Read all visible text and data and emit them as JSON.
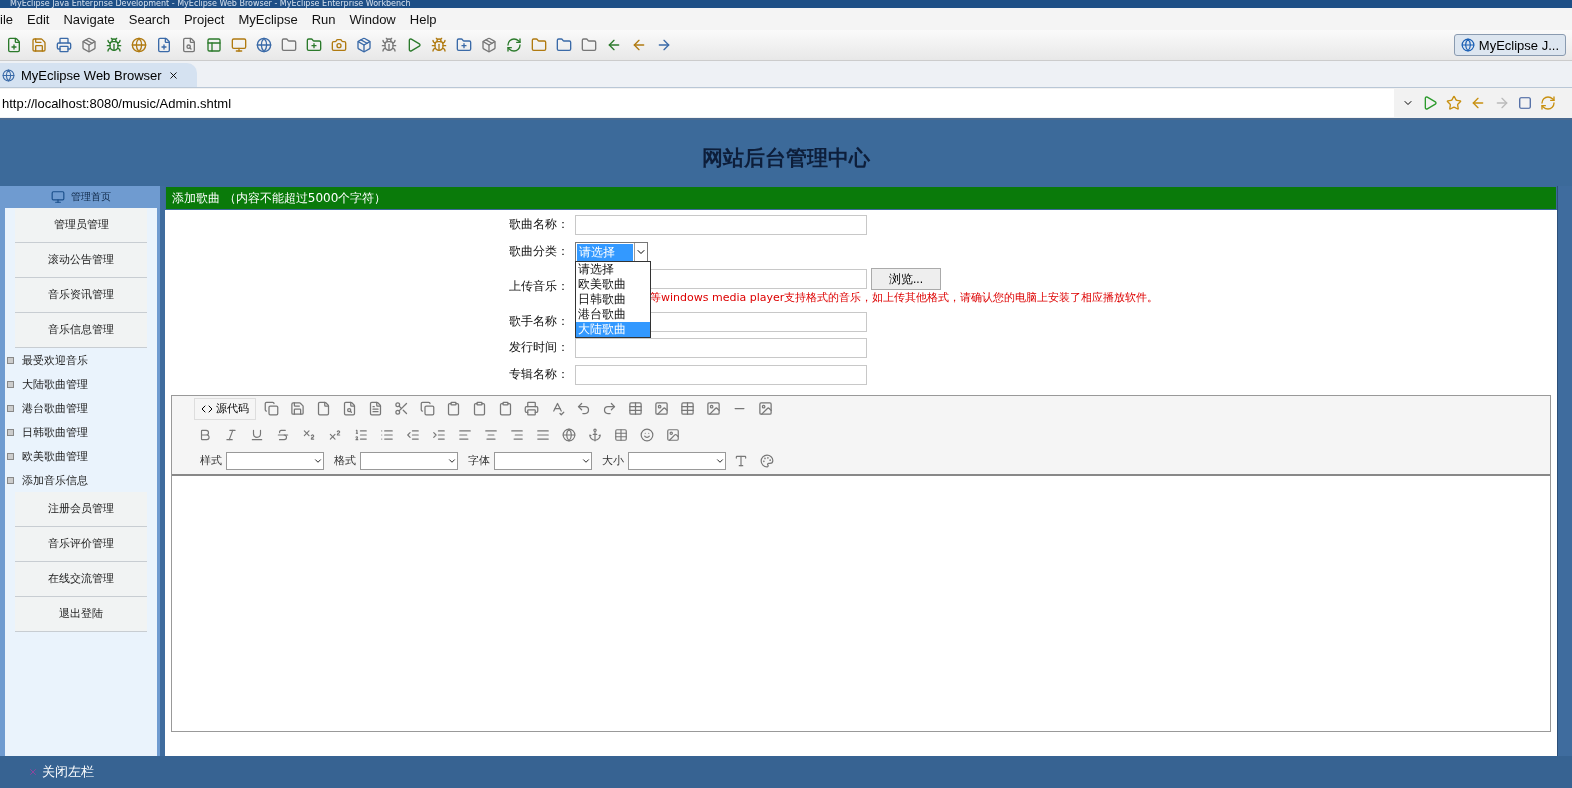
{
  "window": {
    "title": "MyEclipse Java Enterprise Development - MyEclipse Web Browser - MyEclipse Enterprise Workbench"
  },
  "menu": [
    "ile",
    "Edit",
    "Navigate",
    "Search",
    "Project",
    "MyEclipse",
    "Run",
    "Window",
    "Help"
  ],
  "toolbar": {
    "perspective": "MyEclipse J..."
  },
  "tab": {
    "label": "MyEclipse Web Browser"
  },
  "url": "http://localhost:8080/music/Admin.shtml",
  "page": {
    "title": "网站后台管理中心"
  },
  "sidebar": {
    "home": "管理首页",
    "items": [
      {
        "label": "管理员管理",
        "kind": "section"
      },
      {
        "label": "滚动公告管理",
        "kind": "section"
      },
      {
        "label": "音乐资讯管理",
        "kind": "section"
      },
      {
        "label": "音乐信息管理",
        "kind": "section"
      },
      {
        "label": "最受欢迎音乐",
        "kind": "sub"
      },
      {
        "label": "大陆歌曲管理",
        "kind": "sub"
      },
      {
        "label": "港台歌曲管理",
        "kind": "sub"
      },
      {
        "label": "日韩歌曲管理",
        "kind": "sub"
      },
      {
        "label": "欧美歌曲管理",
        "kind": "sub"
      },
      {
        "label": "添加音乐信息",
        "kind": "sub"
      },
      {
        "label": "注册会员管理",
        "kind": "section"
      },
      {
        "label": "音乐评价管理",
        "kind": "section"
      },
      {
        "label": "在线交流管理",
        "kind": "section"
      },
      {
        "label": "退出登陆",
        "kind": "section"
      }
    ]
  },
  "form": {
    "header": "添加歌曲 （内容不能超过5000个字符）",
    "fields": [
      {
        "label": "歌曲名称：",
        "kind": "text"
      },
      {
        "label": "歌曲分类：",
        "kind": "select",
        "value": "请选择",
        "options": [
          {
            "label": "请选择",
            "highlighted": false
          },
          {
            "label": "欧美歌曲",
            "highlighted": false
          },
          {
            "label": "日韩歌曲",
            "highlighted": false
          },
          {
            "label": "港台歌曲",
            "highlighted": false
          },
          {
            "label": "大陆歌曲",
            "highlighted": true
          }
        ]
      },
      {
        "label": "上传音乐：",
        "kind": "file",
        "button": "浏览...",
        "hint": "等windows media player支持格式的音乐，如上传其他格式，请确认您的电脑上安装了相应播放软件。"
      },
      {
        "label": "歌手名称：",
        "kind": "text"
      },
      {
        "label": "发行时间：",
        "kind": "text"
      },
      {
        "label": "专辑名称：",
        "kind": "text"
      }
    ]
  },
  "editor": {
    "source_button": "源代码",
    "dropdowns": [
      "样式",
      "格式",
      "字体",
      "大小"
    ]
  },
  "footer": {
    "close_sidebar": "关闭左栏"
  }
}
